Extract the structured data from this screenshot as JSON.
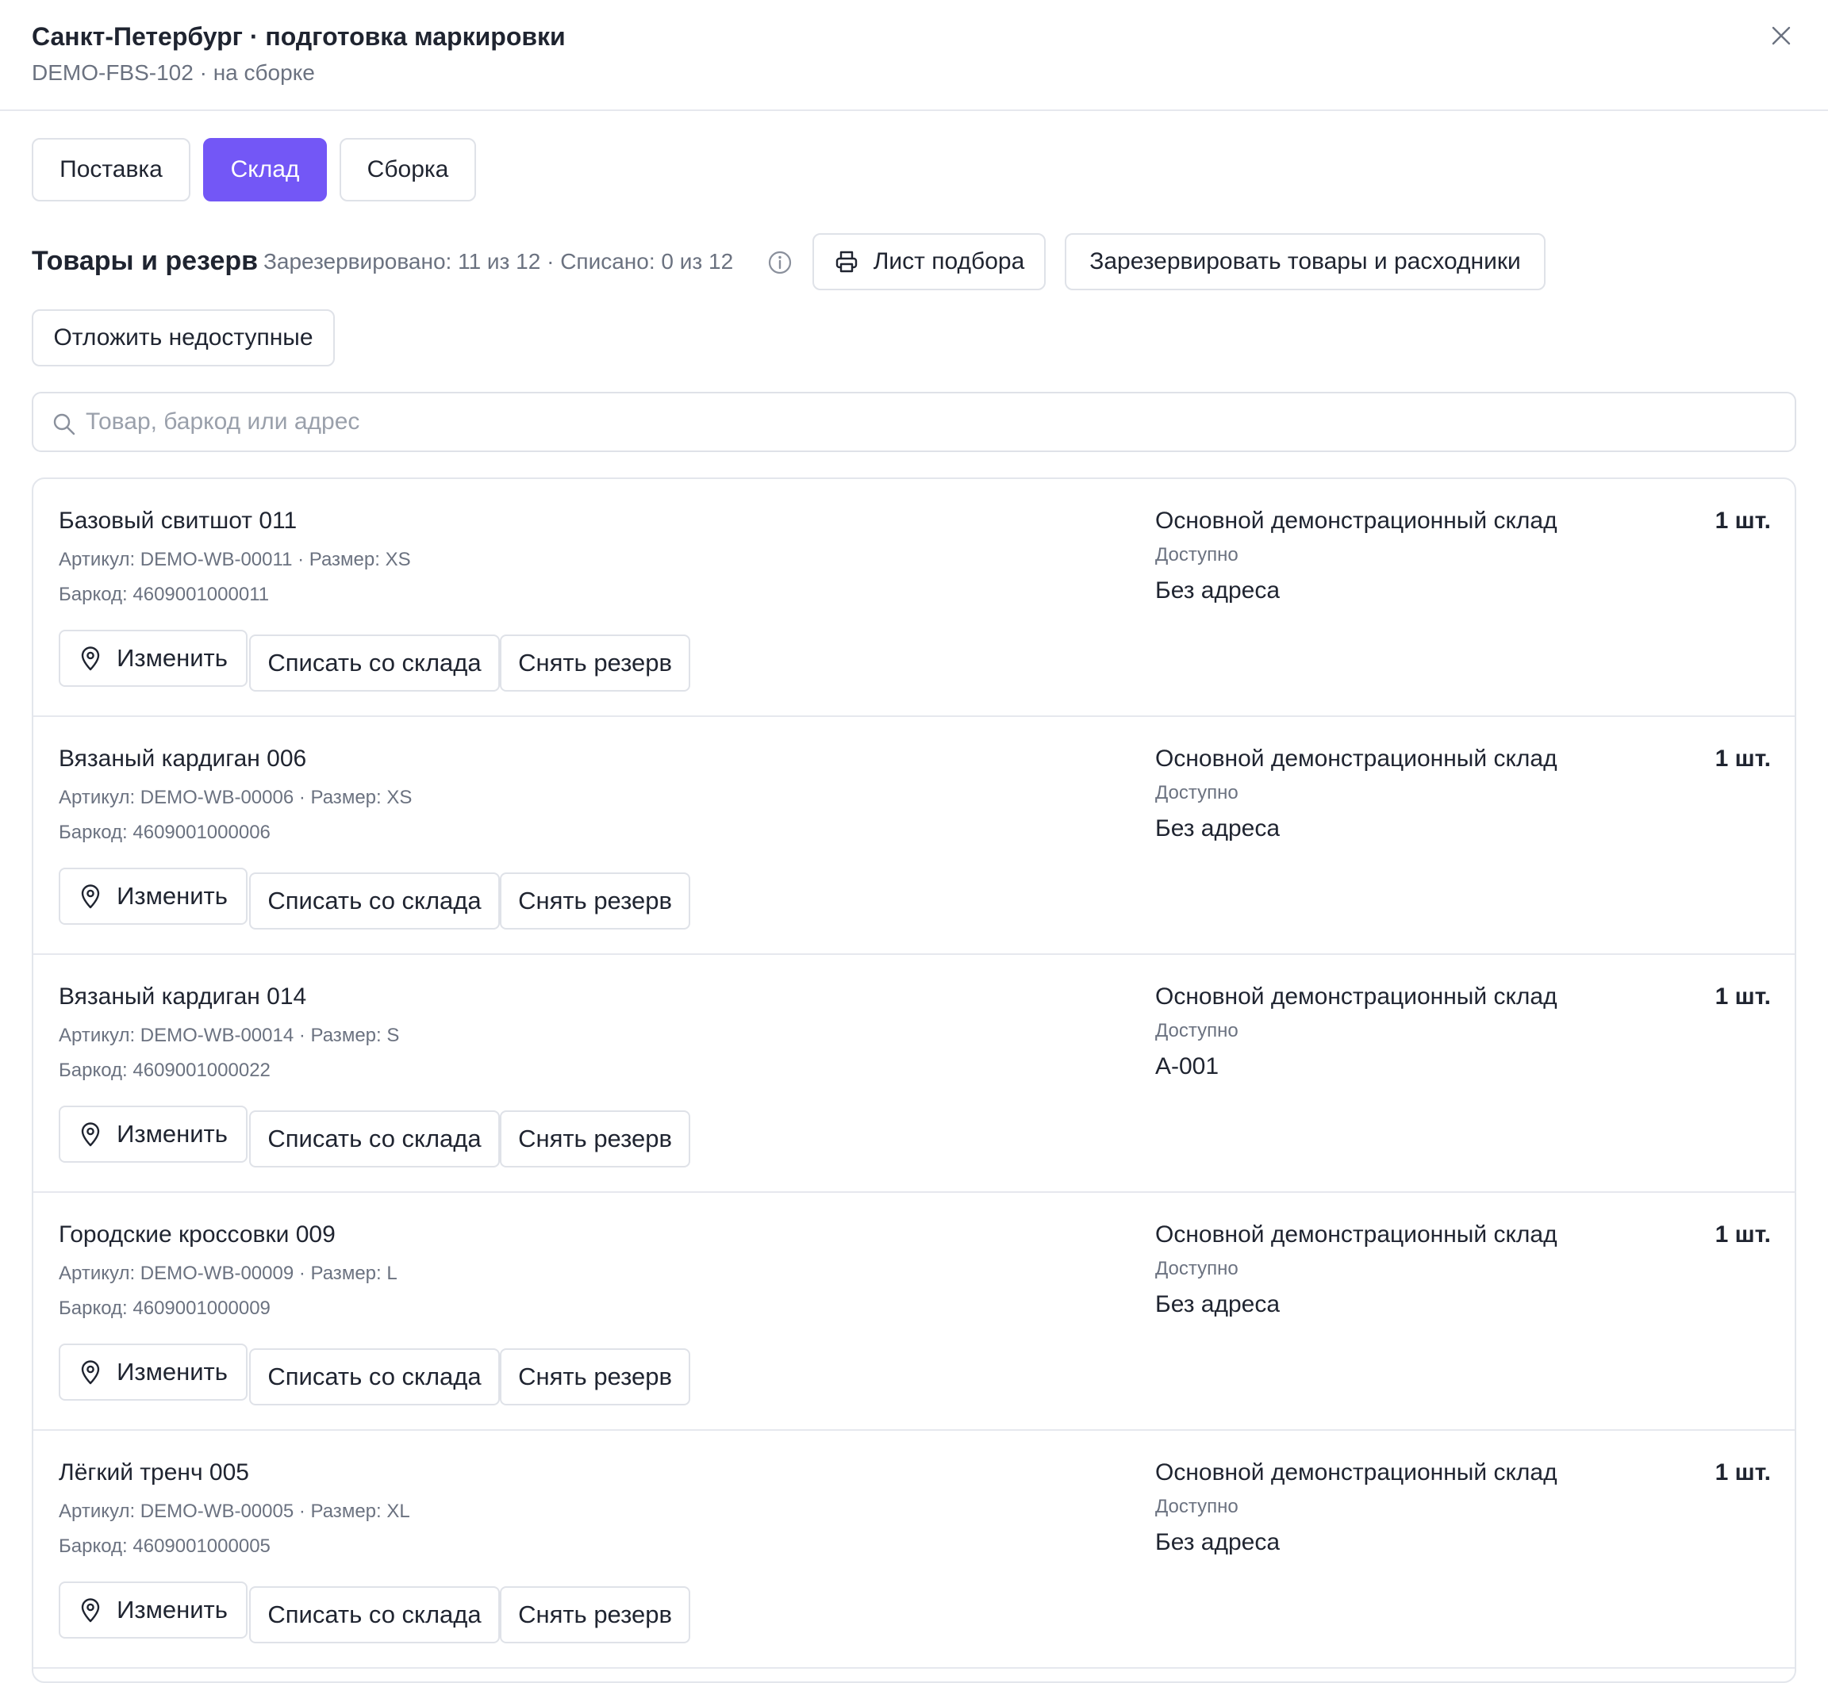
{
  "header": {
    "title": "Санкт-Петербург · подготовка маркировки",
    "subtitle": "DEMO-FBS-102 · на сборке",
    "close_icon": "close-icon"
  },
  "tabs": [
    {
      "label": "Поставка",
      "active": false
    },
    {
      "label": "Склад",
      "active": true
    },
    {
      "label": "Сборка",
      "active": false
    }
  ],
  "section": {
    "title": "Товары и резерв",
    "stats": "Зарезервировано: 11 из 12 · Списано: 0 из 12",
    "info_icon": "info-icon"
  },
  "toolbar": {
    "pick_list_label": "Лист подбора",
    "pick_list_icon": "printer-icon",
    "reserve_label": "Зарезервировать товары и расходники",
    "postpone_label": "Отложить недоступные"
  },
  "search": {
    "placeholder": "Товар, баркод или адрес",
    "value": ""
  },
  "colors": {
    "accent": "#7357f6",
    "border": "#dfe2e8",
    "muted_text": "#6b7280",
    "text": "#1f2430"
  },
  "item_actions": {
    "change_label": "Изменить",
    "change_icon": "map-pin-icon",
    "write_off_label": "Списать со склада",
    "unreserve_label": "Снять резерв"
  },
  "items": [
    {
      "name": "Базовый свитшот 011",
      "meta": "Артикул: DEMO-WB-00011 · Размер: XS",
      "barcode": "Баркод: 4609001000011",
      "warehouse": "Основной демонстрационный склад",
      "status": "Доступно",
      "address": "Без адреса",
      "qty": "1 шт."
    },
    {
      "name": "Вязаный кардиган 006",
      "meta": "Артикул: DEMO-WB-00006 · Размер: XS",
      "barcode": "Баркод: 4609001000006",
      "warehouse": "Основной демонстрационный склад",
      "status": "Доступно",
      "address": "Без адреса",
      "qty": "1 шт."
    },
    {
      "name": "Вязаный кардиган 014",
      "meta": "Артикул: DEMO-WB-00014 · Размер: S",
      "barcode": "Баркод: 4609001000022",
      "warehouse": "Основной демонстрационный склад",
      "status": "Доступно",
      "address": "A-001",
      "qty": "1 шт."
    },
    {
      "name": "Городские кроссовки 009",
      "meta": "Артикул: DEMO-WB-00009 · Размер: L",
      "barcode": "Баркод: 4609001000009",
      "warehouse": "Основной демонстрационный склад",
      "status": "Доступно",
      "address": "Без адреса",
      "qty": "1 шт."
    },
    {
      "name": "Лёгкий тренч 005",
      "meta": "Артикул: DEMO-WB-00005 · Размер: XL",
      "barcode": "Баркод: 4609001000005",
      "warehouse": "Основной демонстрационный склад",
      "status": "Доступно",
      "address": "Без адреса",
      "qty": "1 шт."
    }
  ]
}
